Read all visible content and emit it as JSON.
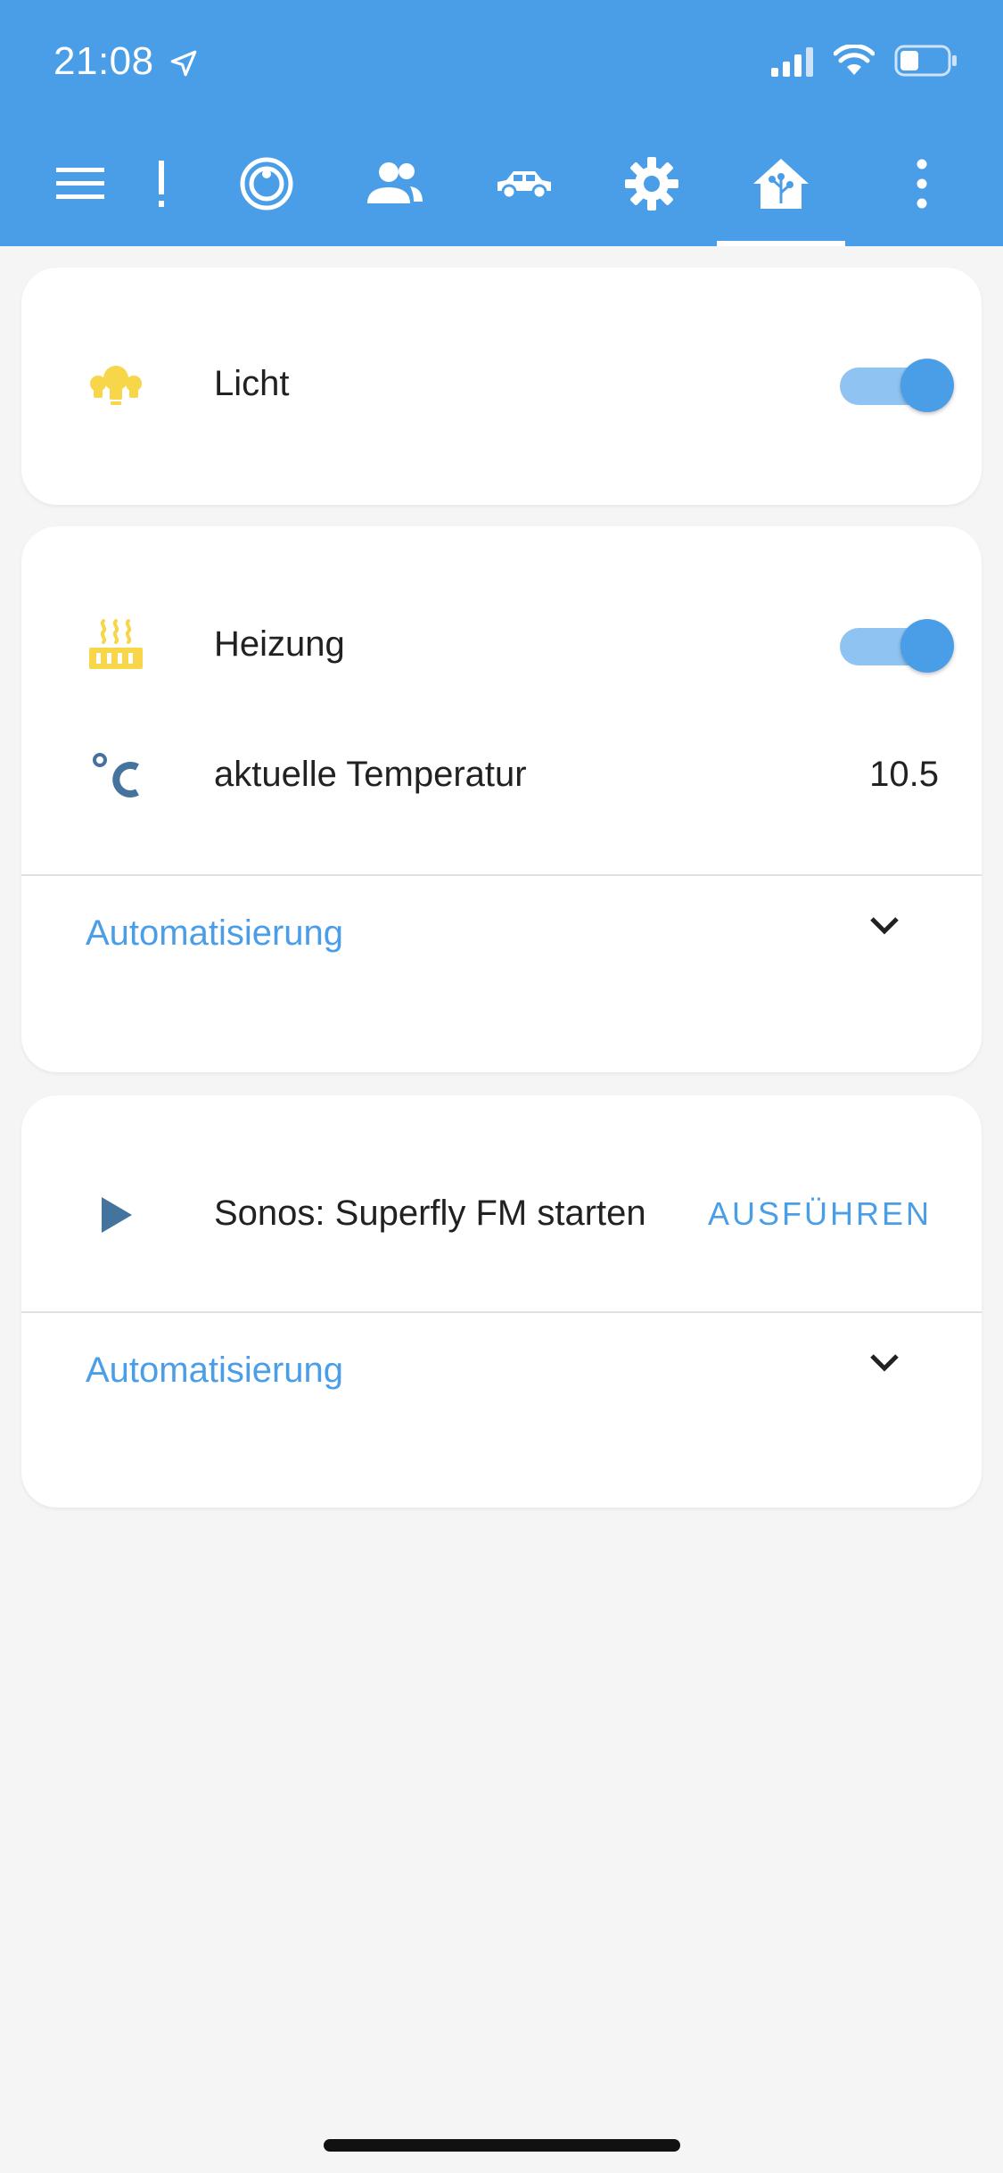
{
  "status_bar": {
    "time": "21:08",
    "icons": [
      "location-arrow-icon",
      "signal-icon",
      "wifi-icon",
      "battery-icon"
    ]
  },
  "toolbar": {
    "menu_icon": "hamburger-menu-icon",
    "tabs": [
      {
        "icon": "alert-icon"
      },
      {
        "icon": "robot-vacuum-icon"
      },
      {
        "icon": "people-icon"
      },
      {
        "icon": "car-icon"
      },
      {
        "icon": "gear-icon"
      },
      {
        "icon": "home-assistant-icon",
        "selected": true
      }
    ],
    "more_icon": "more-vertical-icon"
  },
  "cards": {
    "light": {
      "label": "Licht",
      "icon": "lightbulbs-icon",
      "state": "on"
    },
    "heating": {
      "label": "Heizung",
      "icon": "radiator-icon",
      "state": "on",
      "temperature_label": "aktuelle Temperatur",
      "temperature_icon": "celsius-icon",
      "temperature_value": "10.5",
      "expander_label": "Automatisierung"
    },
    "sonos": {
      "label": "Sonos: Superfly FM starten",
      "icon": "play-icon",
      "run_label": "AUSFÜHREN",
      "expander_label": "Automatisierung"
    }
  },
  "colors": {
    "accent": "#4a9ee8",
    "toggle_track": "#8fc3f2",
    "icon_yellow": "#f7d64a",
    "icon_slate": "#44739e",
    "background": "#f5f5f5"
  }
}
